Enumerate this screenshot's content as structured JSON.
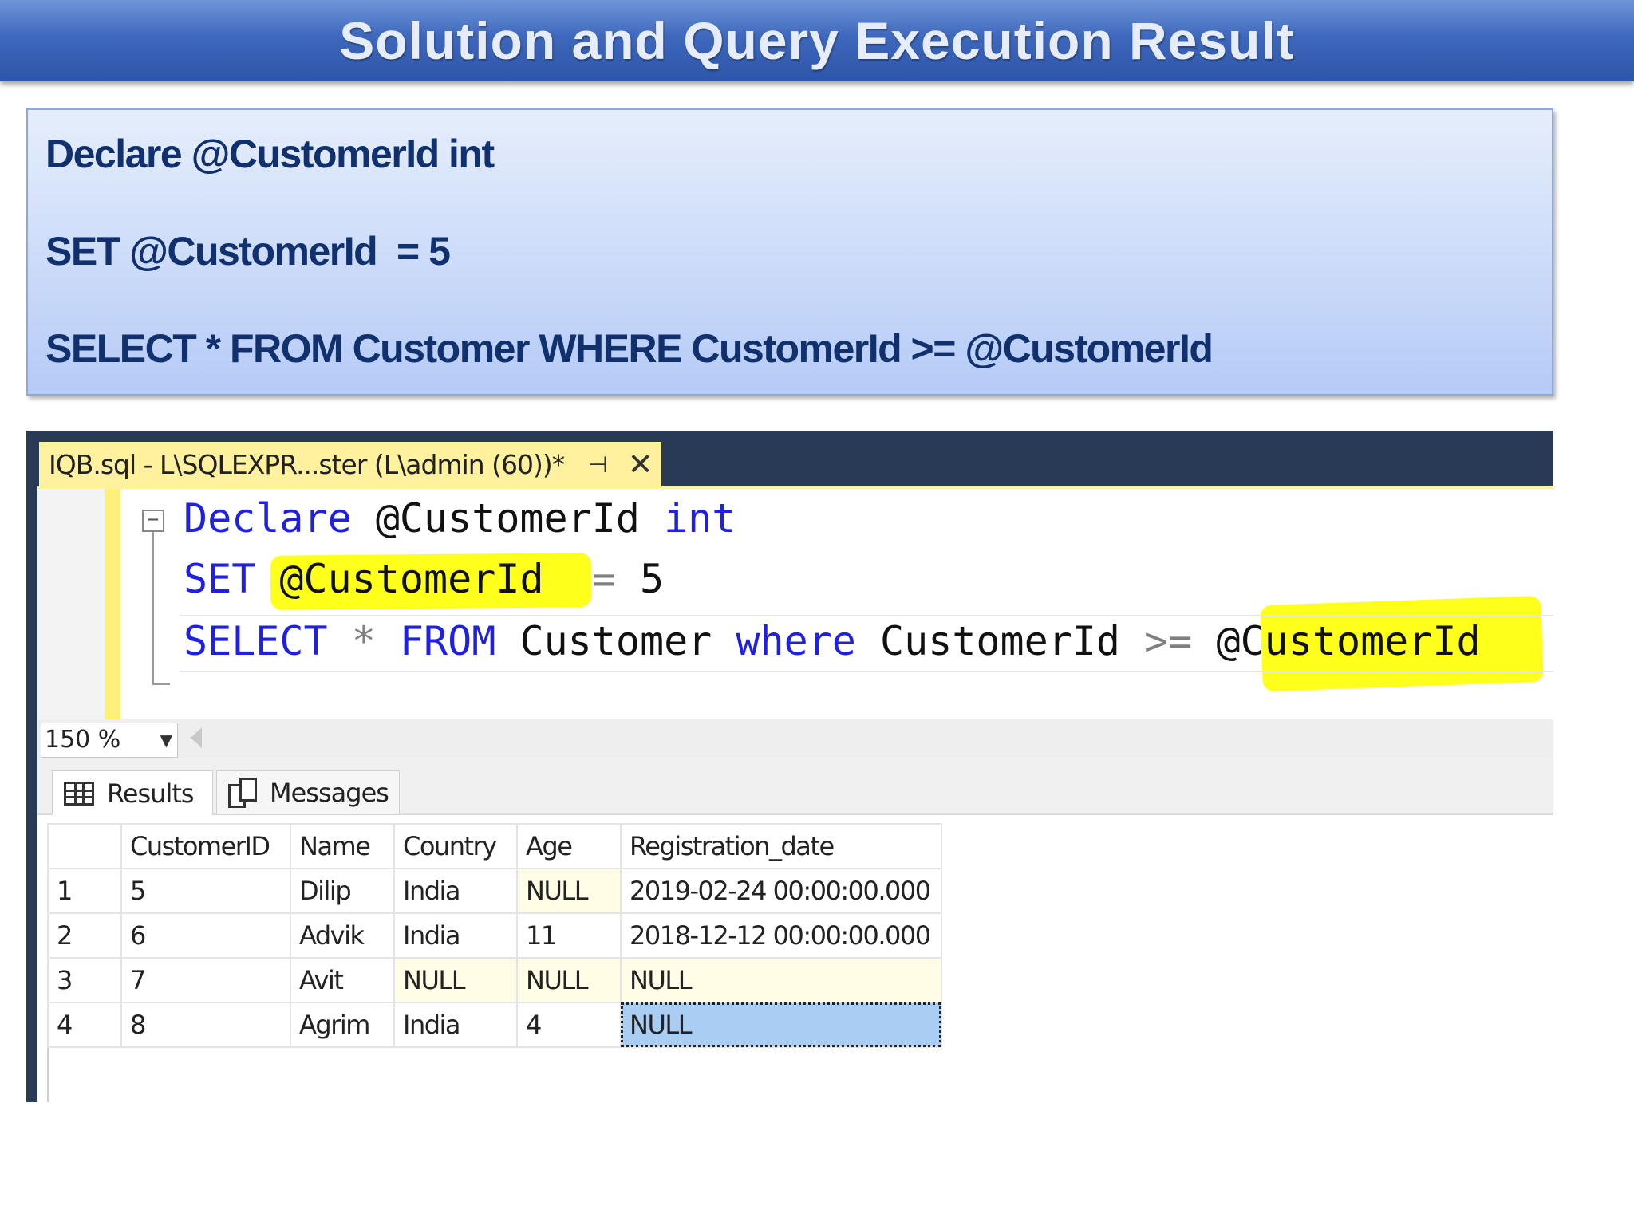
{
  "banner": {
    "title": "Solution and Query Execution Result"
  },
  "query_box": {
    "line1": "Declare @CustomerId int",
    "line2": "SET @CustomerId  = 5",
    "line3": "SELECT * FROM Customer WHERE CustomerId >= @CustomerId"
  },
  "ssms": {
    "document_tab": {
      "title": "IQB.sql - L\\SQLEXPR...ster (L\\admin (60))*",
      "pin_icon": "pin-icon",
      "close_icon": "close-icon"
    },
    "editor": {
      "fold_symbol": "−",
      "line1": {
        "kw1": "Declare",
        "var": " @CustomerId ",
        "kw2": "int"
      },
      "line2": {
        "kw1": "SET",
        "var": " @CustomerId  ",
        "op": "=",
        "val": " 5"
      },
      "line3": {
        "kw1": "SELECT",
        "star": " * ",
        "kw2": "FROM",
        "table": " Customer ",
        "kw3": "where",
        "col": " CustomerId ",
        "op": ">=",
        "var": " @CustomerId"
      },
      "highlight_color": "#ffff1c"
    },
    "zoom": {
      "value": "150 %"
    },
    "results_tabs": [
      {
        "label": "Results",
        "icon": "grid-icon",
        "active": true
      },
      {
        "label": "Messages",
        "icon": "messages-icon",
        "active": false
      }
    ],
    "results_grid": {
      "columns": [
        "",
        "CustomerID",
        "Name",
        "Country",
        "Age",
        "Registration_date"
      ],
      "rows": [
        {
          "n": "1",
          "id": "5",
          "name": "Dilip",
          "country": "India",
          "age": "NULL",
          "reg": "2019-02-24 00:00:00.000"
        },
        {
          "n": "2",
          "id": "6",
          "name": "Advik",
          "country": "India",
          "age": "11",
          "reg": "2018-12-12 00:00:00.000"
        },
        {
          "n": "3",
          "id": "7",
          "name": "Avit",
          "country": "NULL",
          "age": "NULL",
          "reg": "NULL"
        },
        {
          "n": "4",
          "id": "8",
          "name": "Agrim",
          "country": "India",
          "age": "4",
          "reg": "NULL"
        }
      ]
    }
  }
}
